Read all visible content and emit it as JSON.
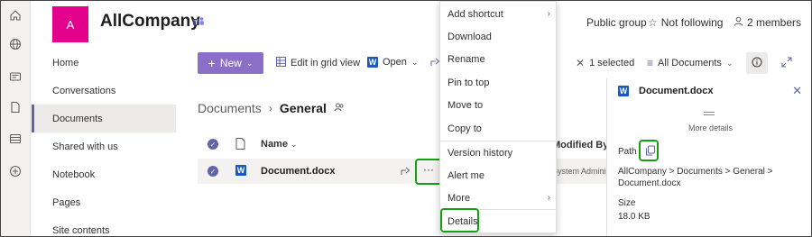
{
  "site": {
    "logo_letter": "A",
    "title": "AllCompany",
    "group_type": "Public group",
    "follow_label": "Not following",
    "members_label": "2 members"
  },
  "nav": {
    "items": [
      {
        "label": "Home"
      },
      {
        "label": "Conversations"
      },
      {
        "label": "Documents"
      },
      {
        "label": "Shared with us"
      },
      {
        "label": "Notebook"
      },
      {
        "label": "Pages"
      },
      {
        "label": "Site contents"
      }
    ],
    "active_index": 2
  },
  "commandbar": {
    "new_label": "New",
    "grid_label": "Edit in grid view",
    "open_label": "Open",
    "selected_label": "1 selected",
    "view_label": "All Documents"
  },
  "breadcrumb": {
    "parent": "Documents",
    "current": "General"
  },
  "list": {
    "name_header": "Name",
    "modified_header": "Modified By",
    "rows": [
      {
        "name": "Document.docx",
        "modified_by": "System Administ"
      }
    ]
  },
  "context_menu": {
    "items": [
      {
        "label": "Add shortcut",
        "submenu": true
      },
      {
        "label": "Download",
        "submenu": false
      },
      {
        "label": "Rename",
        "submenu": false
      },
      {
        "label": "Pin to top",
        "submenu": false
      },
      {
        "label": "Move to",
        "submenu": false
      },
      {
        "label": "Copy to",
        "submenu": false
      },
      {
        "label": "Version history",
        "submenu": false
      },
      {
        "label": "Alert me",
        "submenu": false
      },
      {
        "label": "More",
        "submenu": true
      },
      {
        "label": "Details",
        "submenu": false
      }
    ]
  },
  "details": {
    "file_name": "Document.docx",
    "more_details": "More details",
    "path_label": "Path",
    "path_value": "AllCompany > Documents > General > Document.docx",
    "size_label": "Size",
    "size_value": "18.0 KB"
  },
  "colors": {
    "accent": "#6264a7",
    "new_button": "#8b6fc7",
    "logo": "#e3008c",
    "highlight": "#13a10e"
  }
}
